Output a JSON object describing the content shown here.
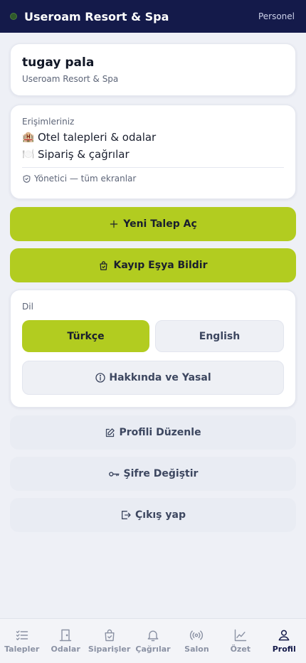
{
  "header": {
    "app_title": "Useroam Resort & Spa",
    "role": "Personel"
  },
  "profile": {
    "name": "tugay pala",
    "hotel": "Useroam Resort & Spa"
  },
  "access": {
    "label": "Erişimleriniz",
    "items": [
      {
        "icon": "🏨",
        "label": "Otel talepleri & odalar"
      },
      {
        "icon": "🍽️",
        "label": "Sipariş & çağrılar"
      }
    ],
    "role_text": "Yönetici — tüm ekranlar"
  },
  "actions": {
    "new_request": "Yeni Talep Aç",
    "lost_item": "Kayıp Eşya Bildir"
  },
  "language": {
    "label": "Dil",
    "options": [
      "Türkçe",
      "English"
    ],
    "selected": "Türkçe",
    "about": "Hakkında ve Yasal"
  },
  "account": {
    "edit_profile": "Profili Düzenle",
    "change_password": "Şifre Değiştir",
    "logout": "Çıkış yap"
  },
  "nav": {
    "items": [
      {
        "icon": "list-check-icon",
        "label": "Talepler"
      },
      {
        "icon": "door-icon",
        "label": "Odalar"
      },
      {
        "icon": "shopping-bag-icon",
        "label": "Siparişler"
      },
      {
        "icon": "bell-icon",
        "label": "Çağrılar"
      },
      {
        "icon": "broadcast-icon",
        "label": "Salon"
      },
      {
        "icon": "chart-line-icon",
        "label": "Özet"
      },
      {
        "icon": "user-icon",
        "label": "Profil"
      }
    ],
    "active": "Profil"
  },
  "colors": {
    "header_bg": "#141a4a",
    "accent": "#b2cc20",
    "page_bg": "#eef0f6"
  }
}
